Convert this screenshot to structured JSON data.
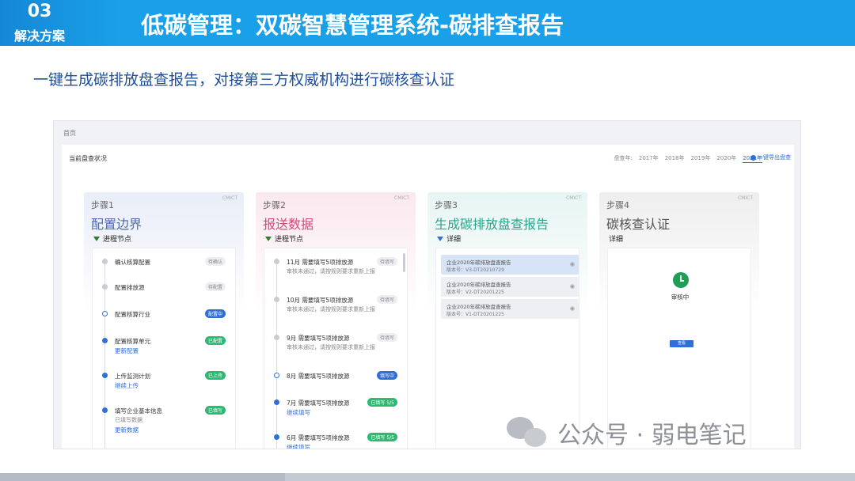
{
  "section": {
    "number": "03",
    "label": "解决方案"
  },
  "title": "低碳管理：双碳智慧管理系统-碳排查报告",
  "subtitle": "一键生成碳排放盘查报告，对接第三方权威机构进行碳核查认证",
  "app": {
    "breadcrumb": "首页",
    "panel_title": "当前盘查状况",
    "years_label": "盘查年:",
    "years": [
      "2017年",
      "2018年",
      "2019年",
      "2020年",
      "2021年"
    ],
    "export_label": "一键导出盘查",
    "cards": [
      {
        "step": "步骤1",
        "name": "配置边界",
        "cmict": "CMICT",
        "section": "进程节点",
        "nodes": [
          {
            "label": "确认核算配置",
            "tag": "待确认",
            "desc": "",
            "link": "",
            "link2": ""
          },
          {
            "label": "配置排放源",
            "tag": "待配置",
            "desc": "",
            "link": "",
            "link2": ""
          },
          {
            "label": "配置核算行业",
            "tag": "配置中",
            "desc": "",
            "link": "",
            "link2": ""
          },
          {
            "label": "配置核算单元",
            "tag": "已配置",
            "desc": "",
            "link": "更新配置",
            "link2": ""
          },
          {
            "label": "上传监测计划",
            "tag": "已上传",
            "desc": "",
            "link": "继续上传",
            "link2": ""
          },
          {
            "label": "填写企业基本信息",
            "tag": "已填写",
            "desc": "已填写数据",
            "link": "",
            "link2": "更新数据"
          }
        ]
      },
      {
        "step": "步骤2",
        "name": "报送数据",
        "cmict": "CMICT",
        "section": "进程节点",
        "nodes": [
          {
            "label": "11月 需要填写5项排放源",
            "tag": "待填写",
            "desc": "审核未通过，请按规则要求重新上报",
            "link": "",
            "link2": ""
          },
          {
            "label": "10月 需要填写5项排放源",
            "tag": "待填写",
            "desc": "审核未通过，请按规则要求重新上报",
            "link": "",
            "link2": ""
          },
          {
            "label": "9月 需要填写5项排放源",
            "tag": "待填写",
            "desc": "审核未通过，请按规则要求重新上报",
            "link": "",
            "link2": ""
          },
          {
            "label": "8月 需要填写5项排放源",
            "tag": "填写中",
            "desc": "",
            "link": "",
            "link2": ""
          },
          {
            "label": "7月 需要填写5项排放源",
            "tag": "已填写 5/5",
            "desc": "",
            "link": "继续填写",
            "link2": ""
          },
          {
            "label": "6月 需要填写5项排放源",
            "tag": "已填写 5/5",
            "desc": "",
            "link": "继续填写",
            "link2": ""
          }
        ]
      },
      {
        "step": "步骤3",
        "name": "生成碳排放盘查报告",
        "cmict": "CMICT",
        "section": "详细",
        "reports": [
          {
            "title": "企业2020年碳排放盘查报告",
            "version": "版本号：V3-DT20210729"
          },
          {
            "title": "企业2020年碳排放盘查报告",
            "version": "版本号：V2-DT20201225"
          },
          {
            "title": "企业2020年碳排放盘查报告",
            "version": "版本号：V1-DT20201225"
          }
        ]
      },
      {
        "step": "步骤4",
        "name": "碳核查认证",
        "cmict": "CMICT",
        "section": "详细",
        "status": "审核中",
        "button": "查看"
      }
    ]
  },
  "watermark": "公众号 · 弱电笔记",
  "colors": {
    "header": "#1aa0e8",
    "subtitle": "#1d4e9e",
    "accent": "#2f6fd6",
    "success": "#2eb872"
  }
}
